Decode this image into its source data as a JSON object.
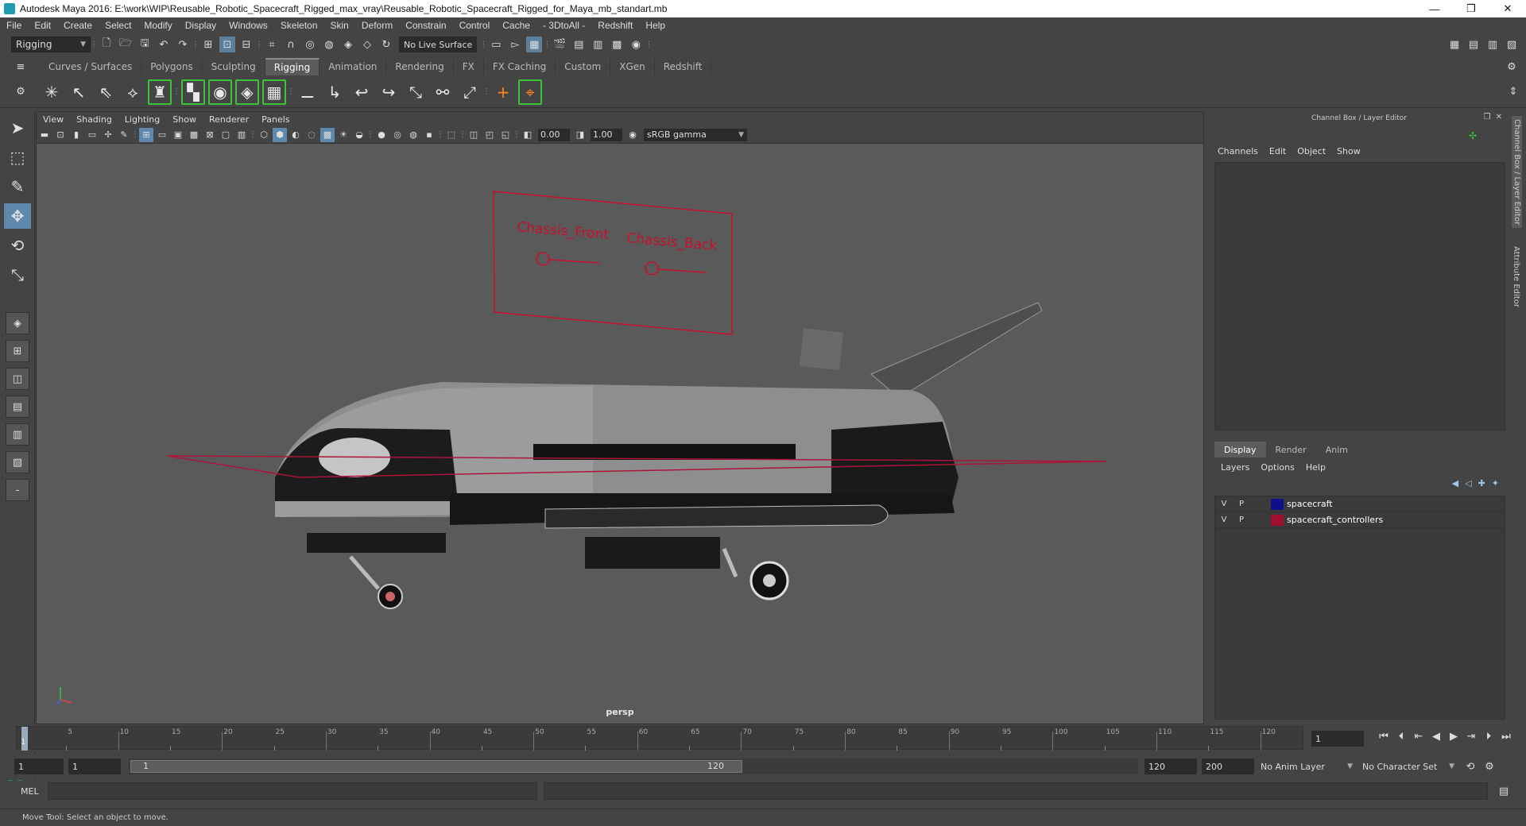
{
  "window": {
    "title": "Autodesk Maya 2016: E:\\work\\WIP\\Reusable_Robotic_Spacecraft_Rigged_max_vray\\Reusable_Robotic_Spacecraft_Rigged_for_Maya_mb_standart.mb",
    "minimize": "—",
    "restore": "❐",
    "close": "✕"
  },
  "menu": [
    "File",
    "Edit",
    "Create",
    "Select",
    "Modify",
    "Display",
    "Windows",
    "Skeleton",
    "Skin",
    "Deform",
    "Constrain",
    "Control",
    "Cache",
    "- 3DtoAll -",
    "Redshift",
    "Help"
  ],
  "status": {
    "mode": "Rigging",
    "live_surface": "No Live Surface"
  },
  "shelf_tabs": [
    "Curves / Surfaces",
    "Polygons",
    "Sculpting",
    "Rigging",
    "Animation",
    "Rendering",
    "FX",
    "FX Caching",
    "Custom",
    "XGen",
    "Redshift"
  ],
  "viewport": {
    "menu": [
      "View",
      "Shading",
      "Lighting",
      "Show",
      "Renderer",
      "Panels"
    ],
    "exposure": "0.00",
    "gamma_value": "1.00",
    "color_space": "sRGB gamma",
    "camera": "persp",
    "controllers": {
      "front": "Chassis_Front",
      "back": "Chassis_Back"
    }
  },
  "channel_box": {
    "title": "Channel Box / Layer Editor",
    "menu": [
      "Channels",
      "Edit",
      "Object",
      "Show"
    ]
  },
  "layer_editor": {
    "tabs": [
      "Display",
      "Render",
      "Anim"
    ],
    "menu": [
      "Layers",
      "Options",
      "Help"
    ],
    "layers": [
      {
        "v": "V",
        "p": "P",
        "name": "spacecraft",
        "color": "#0f0f8c"
      },
      {
        "v": "V",
        "p": "P",
        "name": "spacecraft_controllers",
        "color": "#a0102e"
      }
    ]
  },
  "side_tabs": [
    "Channel Box / Layer Editor",
    "Attribute Editor"
  ],
  "timeline": {
    "ticks": [
      {
        "label": "5",
        "major": false
      },
      {
        "label": "10",
        "major": true
      },
      {
        "label": "15",
        "major": false
      },
      {
        "label": "20",
        "major": true
      },
      {
        "label": "25",
        "major": false
      },
      {
        "label": "30",
        "major": true
      },
      {
        "label": "35",
        "major": false
      },
      {
        "label": "40",
        "major": true
      },
      {
        "label": "45",
        "major": false
      },
      {
        "label": "50",
        "major": true
      },
      {
        "label": "55",
        "major": false
      },
      {
        "label": "60",
        "major": true
      },
      {
        "label": "65",
        "major": false
      },
      {
        "label": "70",
        "major": true
      },
      {
        "label": "75",
        "major": false
      },
      {
        "label": "80",
        "major": true
      },
      {
        "label": "85",
        "major": false
      },
      {
        "label": "90",
        "major": true
      },
      {
        "label": "95",
        "major": false
      },
      {
        "label": "100",
        "major": true
      },
      {
        "label": "105",
        "major": false
      },
      {
        "label": "110",
        "major": true
      },
      {
        "label": "115",
        "major": false
      },
      {
        "label": "120",
        "major": true
      }
    ],
    "start_label": "1",
    "current_frame": "1"
  },
  "range": {
    "start": "1",
    "playback_start": "1",
    "slider_start": "1",
    "slider_end": "120",
    "playback_end": "120",
    "end": "200",
    "anim_layer": "No Anim Layer",
    "character_set": "No Character Set"
  },
  "command": {
    "label": "MEL"
  },
  "help_line": "Move Tool: Select an object to move."
}
